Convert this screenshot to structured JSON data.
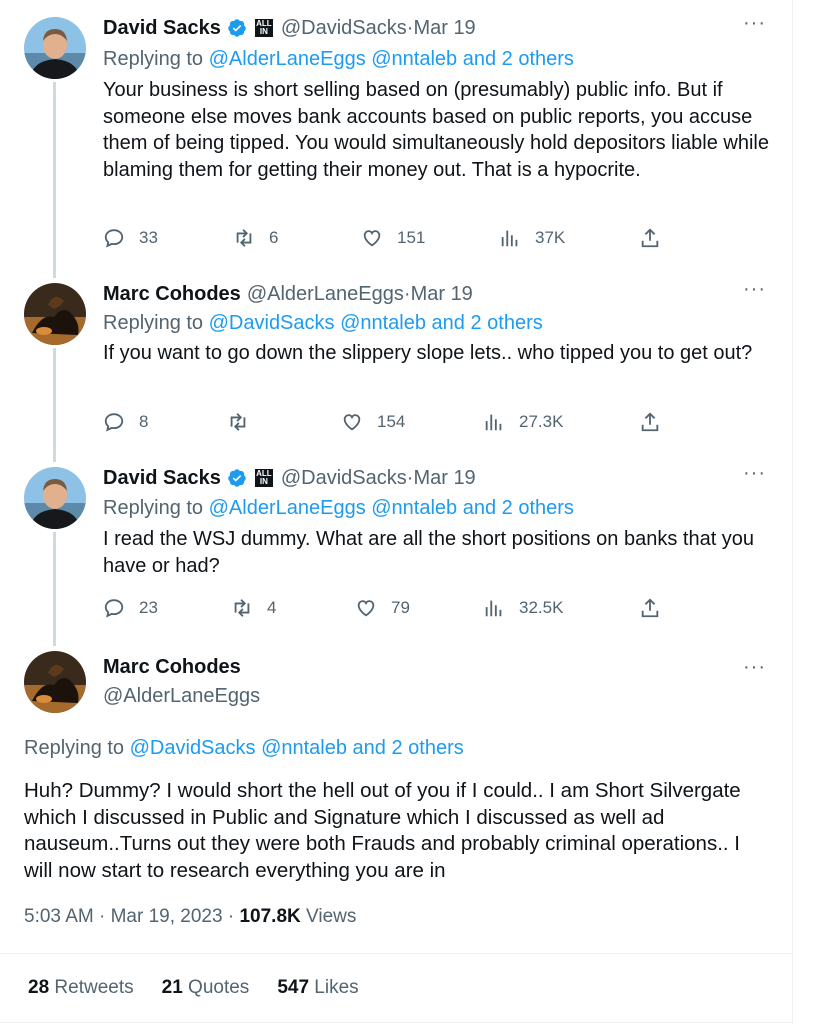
{
  "tweets": [
    {
      "name": "David Sacks",
      "handle": "@DavidSacks",
      "date": "Mar 19",
      "replying_prefix": "Replying to ",
      "mentions": "@AlderLaneEggs @nntaleb",
      "and_others": " and 2 others",
      "text": "Your business is short selling based on (presumably) public info. But if someone else moves bank accounts based on public reports, you accuse them of being tipped. You would simultaneously hold depositors liable while blaming them for getting their money out. That is a hypocrite.",
      "replies": "33",
      "retweets": "6",
      "likes": "151",
      "views": "37K",
      "badge": "ALL IN"
    },
    {
      "name": "Marc Cohodes",
      "handle": "@AlderLaneEggs",
      "date": "Mar 19",
      "replying_prefix": "Replying to ",
      "mentions": "@DavidSacks @nntaleb",
      "and_others": " and 2 others",
      "text": "If you want to go down the slippery slope lets.. who tipped you to get out?",
      "replies": "8",
      "retweets": "",
      "likes": "154",
      "views": "27.3K"
    },
    {
      "name": "David Sacks",
      "handle": "@DavidSacks",
      "date": "Mar 19",
      "replying_prefix": "Replying to ",
      "mentions": "@AlderLaneEggs @nntaleb",
      "and_others": " and 2 others",
      "text": "I read the WSJ dummy. What are all the short positions on banks that you have or had?",
      "replies": "23",
      "retweets": "4",
      "likes": "79",
      "views": "32.5K",
      "badge": "ALL IN"
    }
  ],
  "main": {
    "name": "Marc Cohodes",
    "handle": "@AlderLaneEggs",
    "replying_prefix": "Replying to ",
    "mentions": "@DavidSacks @nntaleb",
    "and_others": " and 2 others",
    "text": "Huh? Dummy? I would short the hell out of you if I could.. I am Short Silvergate which I discussed in Public and Signature which I discussed as well ad nauseum..Turns out they were both Frauds and probably criminal operations.. I will now start to research everything  you are in",
    "time": "5:03 AM",
    "date": "Mar 19, 2023",
    "views_count": "107.8K",
    "views_label": " Views",
    "retweets_count": "28",
    "retweets_label": " Retweets",
    "quotes_count": "21",
    "quotes_label": " Quotes",
    "likes_count": "547",
    "likes_label": " Likes"
  },
  "ui": {
    "dot": " · ",
    "more": "···"
  },
  "colors": {
    "link": "#1d9bf0",
    "muted": "#536471",
    "verified": "#1d9bf0"
  }
}
